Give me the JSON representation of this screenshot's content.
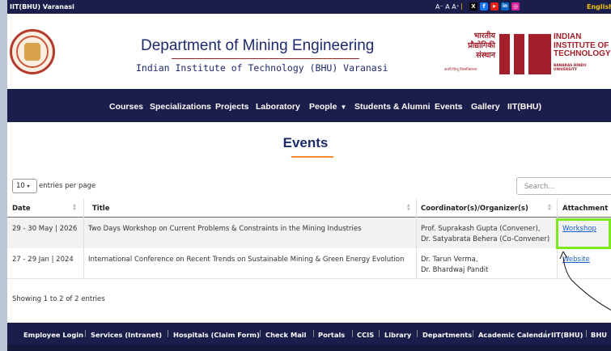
{
  "topbar": {
    "brand": "IIT(BHU) Varanasi",
    "font_sizes": "A⁻ A A⁺",
    "social": [
      {
        "icon": "x-icon",
        "glyph": "X",
        "color": "#000000"
      },
      {
        "icon": "facebook-icon",
        "glyph": "f",
        "color": "#1877f2"
      },
      {
        "icon": "youtube-icon",
        "glyph": "▶",
        "color": "#e62117"
      },
      {
        "icon": "linkedin-icon",
        "glyph": "in",
        "color": "#0a66c2"
      },
      {
        "icon": "instagram-icon",
        "glyph": "◎",
        "color": "#d6249f"
      }
    ],
    "language": "English"
  },
  "header": {
    "department": "Department of Mining Engineering",
    "institute": "Indian Institute of Technology (BHU) Varanasi",
    "iit_logo": {
      "hindi_lines": [
        "भारतीय",
        "प्रौद्योगिकी",
        "संस्थान"
      ],
      "hindi_sub": "काशी हिन्दू विश्वविद्यालय",
      "eng_lines": [
        "INDIAN",
        "INSTITUTE OF",
        "TECHNOLOGY"
      ],
      "eng_sub": "BANARAS HINDU UNIVERSITY"
    }
  },
  "nav": {
    "items": [
      "Courses",
      "Specializations",
      "Projects",
      "Laboratory",
      "People",
      "Students & Alumni",
      "Events",
      "Gallery",
      "IIT(BHU)"
    ]
  },
  "main": {
    "title": "Events",
    "entries_value": "10",
    "entries_label": "entries per page",
    "search_placeholder": "Search...",
    "columns": [
      "Date",
      "Title",
      "Coordinator(s)/Organizer(s)",
      "Attachment"
    ],
    "rows": [
      {
        "date": "29 - 30 May | 2026",
        "title": "Two Days Workshop on Current Problems & Constraints in the Mining Industries",
        "coordinators": [
          "Prof. Suprakash Gupta (Convener),",
          "Dr. Satyabrata Behera (Co-Convener)"
        ],
        "attachment": "Workshop"
      },
      {
        "date": "27 - 29 Jan | 2024",
        "title": "International Conference on Recent Trends on Sustainable Mining & Green Energy Evolution",
        "coordinators": [
          "Dr. Tarun Verma,",
          "Dr. Bhardwaj Pandit"
        ],
        "attachment": "Website"
      }
    ],
    "showing": "Showing 1 to 2 of 2 entries"
  },
  "footer": {
    "links": [
      "Employee Login",
      "Services (Intranet)",
      "Hospitals (Claim Form)",
      "Check Mail",
      "Portals",
      "CCIS",
      "Library",
      "Departments",
      "Academic Calendar",
      "IIT(BHU)",
      "BHU"
    ]
  },
  "colors": {
    "navy": "#1b1d4a",
    "accent_orange": "#f08c3c",
    "link_blue": "#1a5fd1",
    "highlight_green": "#7ee81f",
    "iit_red": "#a31f2b"
  }
}
